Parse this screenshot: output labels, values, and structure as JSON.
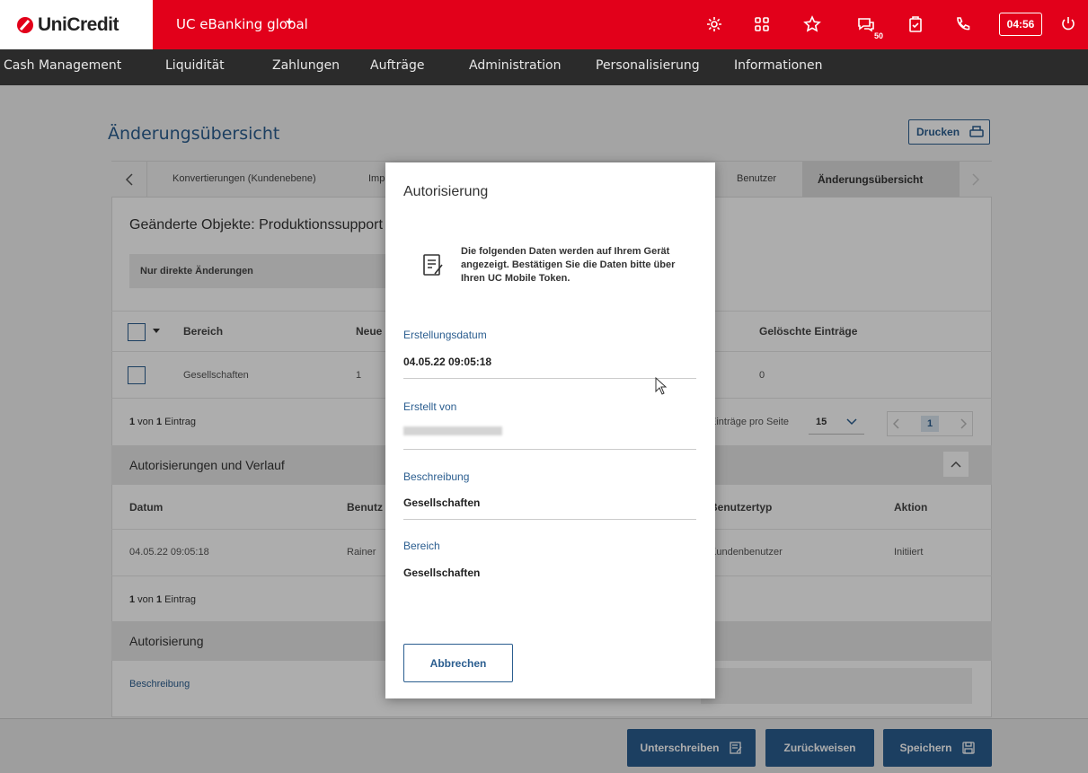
{
  "brand": {
    "logo_text": "UniCredit",
    "app_title": "UC eBanking global",
    "accent": "#e2001a",
    "blue": "#2a5d8f"
  },
  "topbar": {
    "notification_badge": "50",
    "timer": "04:56"
  },
  "nav": [
    "Cash Management",
    "Liquidität",
    "Zahlungen",
    "Aufträge",
    "Administration",
    "Personalisierung",
    "Informationen"
  ],
  "page": {
    "title": "Änderungsübersicht",
    "print_label": "Drucken",
    "tabs": [
      "Konvertierungen (Kundenebene)",
      "Imp",
      "Benutzer",
      "Änderungsübersicht"
    ],
    "changed_objects_title": "Geänderte Objekte: Produktionssupport",
    "filter_label": "Nur direkte Änderungen",
    "objects_table": {
      "headers": [
        "Bereich",
        "Neue",
        "Gelöschte Einträge"
      ],
      "row": [
        "Gesellschaften",
        "1",
        "0"
      ]
    },
    "objects_count": {
      "prefix": "1",
      "mid": " von ",
      "num": "1",
      "suffix": " Eintrag"
    },
    "per_page_label": "Einträge pro Seite",
    "per_page_value": "15",
    "page_number": "1",
    "history_title": "Autorisierungen und Verlauf",
    "history_table": {
      "headers": [
        "Datum",
        "Benutz",
        "Benutzertyp",
        "Aktion"
      ],
      "row": [
        "04.05.22 09:05:18",
        "Rainer",
        "Kundenbenutzer",
        "Initiiert"
      ]
    },
    "history_count": {
      "prefix": "1",
      "mid": " von ",
      "num": "1",
      "suffix": " Eintrag"
    },
    "authorization_title": "Autorisierung",
    "description_label": "Beschreibung"
  },
  "footer": {
    "sign": "Unterschreiben",
    "reject": "Zurückweisen",
    "save": "Speichern"
  },
  "modal": {
    "title": "Autorisierung",
    "info": "Die folgenden Daten werden auf Ihrem Gerät angezeigt. Bestätigen Sie die Daten bitte über Ihren UC Mobile Token.",
    "fields": [
      {
        "label": "Erstellungsdatum",
        "value": "04.05.22 09:05:18"
      },
      {
        "label": "Erstellt von",
        "value": ""
      },
      {
        "label": "Beschreibung",
        "value": "Gesellschaften"
      },
      {
        "label": "Bereich",
        "value": "Gesellschaften"
      }
    ],
    "cancel": "Abbrechen"
  }
}
